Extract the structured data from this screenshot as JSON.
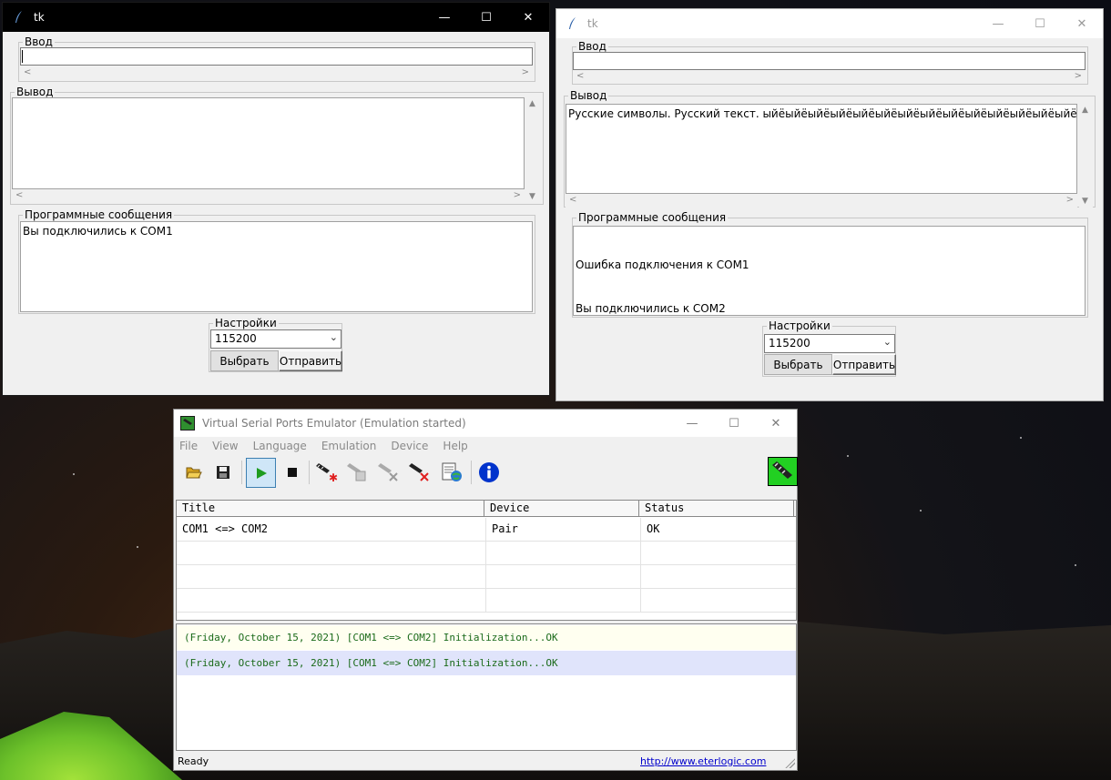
{
  "tk_left": {
    "title": "tk",
    "input_label": "Ввод",
    "input_value": "",
    "output_label": "Вывод",
    "output_text": "",
    "messages_label": "Программные сообщения",
    "messages": [
      "Вы подключились к COM1"
    ],
    "settings_label": "Настройки",
    "baud_selected": "115200",
    "select_button": "Выбрать",
    "send_button": "Отправить"
  },
  "tk_right": {
    "title": "tk",
    "input_label": "Ввод",
    "input_value": "",
    "output_label": "Вывод",
    "output_text": "Русские символы. Русский текст. ыйёыйёыйёыйёыйёыйёыйёыйёыйёыйёыйёыйёыйёыйёыйёыйёыйёыйёый",
    "messages_label": "Программные сообщения",
    "messages": [
      "Ошибка подключения к COM1",
      "Вы подключились к COM2"
    ],
    "settings_label": "Настройки",
    "baud_selected": "115200",
    "select_button": "Выбрать",
    "send_button": "Отправить"
  },
  "vspe": {
    "title": "Virtual Serial Ports Emulator (Emulation started)",
    "menu": [
      "File",
      "View",
      "Language",
      "Emulation",
      "Device",
      "Help"
    ],
    "toolbar_icons": [
      "open-folder-icon",
      "save-disk-icon",
      "play-icon",
      "stop-icon",
      "create-device-icon",
      "edit-device-icon",
      "disconnect-device-icon",
      "delete-device-icon",
      "report-globe-icon",
      "info-icon"
    ],
    "columns": [
      "Title",
      "Device",
      "Status"
    ],
    "rows": [
      {
        "title": "COM1 <=> COM2",
        "device": "Pair",
        "status": "OK"
      }
    ],
    "log": [
      "(Friday, October 15, 2021) [COM1 <=> COM2] Initialization...OK",
      "(Friday, October 15, 2021) [COM1 <=> COM2] Initialization...OK"
    ],
    "status": "Ready",
    "link": "http://www.eterlogic.com",
    "colors": {
      "log_text": "#1a6a1a",
      "log_line1_bg": "#fffff0",
      "log_line2_bg": "#e0e4fb",
      "play_green": "#1e9c1e",
      "info_blue": "#0033cc"
    }
  },
  "window_controls": {
    "minimize": "—",
    "maximize": "☐",
    "close": "✕"
  }
}
